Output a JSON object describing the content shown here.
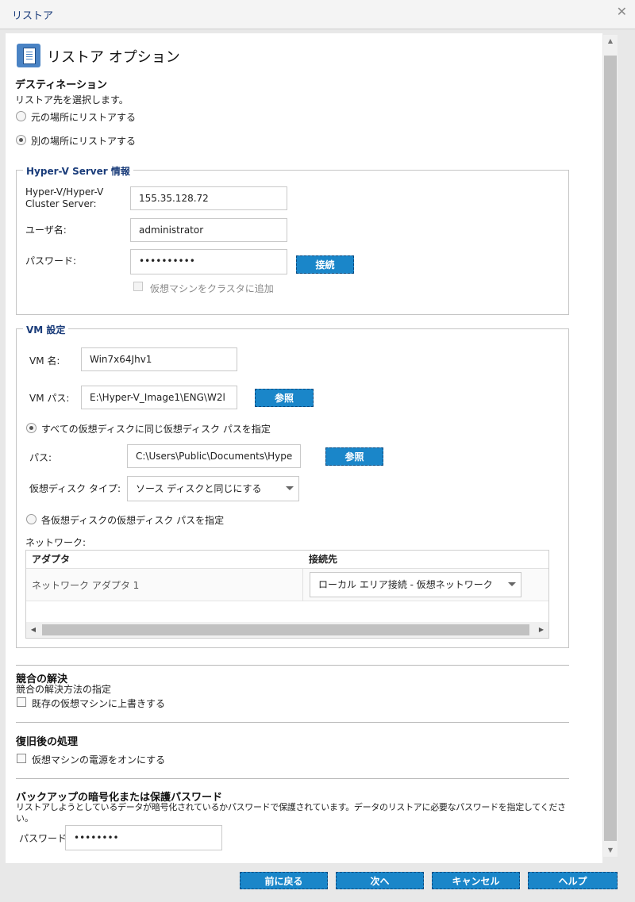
{
  "window": {
    "title": "リストア",
    "close_glyph": "✕"
  },
  "header": {
    "title": "リストア オプション",
    "icon": "restore-options-icon"
  },
  "destination": {
    "title": "デスティネーション",
    "subtitle": "リストア先を選択します。",
    "options": [
      "元の場所にリストアする",
      "別の場所にリストアする"
    ],
    "selected_index": 1
  },
  "hyperv": {
    "legend": "Hyper-V Server 情報",
    "server_label_1": "Hyper-V/Hyper-V",
    "server_label_2": "Cluster Server:",
    "server_value": "155.35.128.72",
    "user_label": "ユーザ名:",
    "user_value": "administrator",
    "password_label": "パスワード:",
    "password_value": "••••••••••",
    "connect_label": "接続",
    "cluster_checkbox_label": "仮想マシンをクラスタに追加",
    "cluster_checked": false
  },
  "vm": {
    "legend": "VM 設定",
    "name_label": "VM 名:",
    "name_value": "Win7x64Jhv1",
    "path_label": "VM パス:",
    "path_value": "E:\\Hyper-V_Image1\\ENG\\W2l",
    "browse_label": "参照",
    "same_path_option": "すべての仮想ディスクに同じ仮想ディスク パスを指定",
    "disk_path_label": "パス:",
    "disk_path_value": "C:\\Users\\Public\\Documents\\Hype",
    "browse_label_2": "参照",
    "disk_type_label": "仮想ディスク タイプ:",
    "disk_type_value": "ソース ディスクと同じにする",
    "each_path_option": "各仮想ディスクの仮想ディスク パスを指定",
    "same_path_selected": true,
    "network_label": "ネットワーク:",
    "network_columns": [
      "アダプタ",
      "接続先"
    ],
    "network_rows": [
      {
        "adapter": "ネットワーク アダプタ 1",
        "connection": "ローカル エリア接続 - 仮想ネットワーク"
      }
    ]
  },
  "conflict": {
    "title": "競合の解決",
    "subtitle": "競合の解決方法の指定",
    "checkbox_label": "既存の仮想マシンに上書きする",
    "checked": false
  },
  "post_recovery": {
    "title": "復旧後の処理",
    "checkbox_label": "仮想マシンの電源をオンにする",
    "checked": false
  },
  "encryption": {
    "title": "バックアップの暗号化または保護パスワード",
    "description_1": "リストアしようとしているデータが暗号化されているかパスワードで保護されています。データのリストアに必要なパスワードを指定してくださ",
    "description_2": "い。",
    "password_label": "パスワード",
    "password_value": "••••••••"
  },
  "footer": {
    "back_label": "前に戻る",
    "next_label": "次へ",
    "cancel_label": "キャンセル",
    "help_label": "ヘルプ"
  },
  "colors": {
    "accent": "#1a86c9",
    "legend_text": "#1a3c7a"
  }
}
